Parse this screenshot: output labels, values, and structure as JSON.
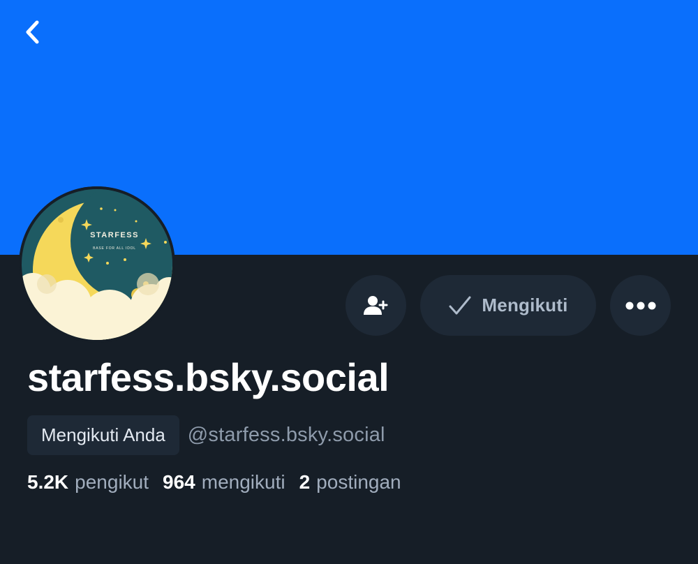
{
  "header": {
    "back_icon": "chevron-left-icon",
    "banner_color": "#0a6ffc"
  },
  "avatar": {
    "logo_text": "STARFESS",
    "logo_subtext": "BASE FOR ALL IDOL"
  },
  "actions": {
    "add_user_icon": "person-add-icon",
    "follow_label": "Mengikuti",
    "follow_icon": "check-icon",
    "more_icon": "more-horizontal-icon"
  },
  "profile": {
    "display_name": "starfess.bsky.social",
    "follows_you_badge": "Mengikuti Anda",
    "handle": "@starfess.bsky.social"
  },
  "stats": {
    "followers_value": "5.2K",
    "followers_label": "pengikut",
    "following_value": "964",
    "following_label": "mengikuti",
    "posts_value": "2",
    "posts_label": "postingan"
  },
  "colors": {
    "background": "#161e27",
    "button_bg": "#1e2936",
    "accent_blue": "#0a6ffc"
  }
}
